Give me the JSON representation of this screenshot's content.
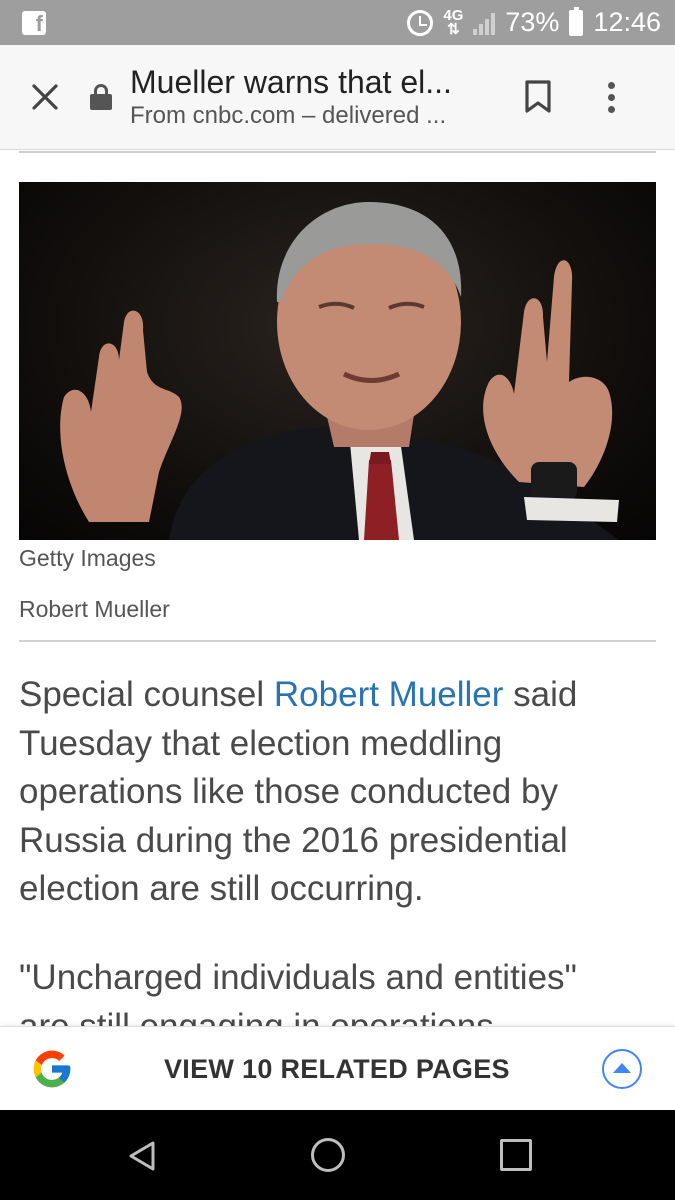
{
  "status_bar": {
    "app_icon": "facebook-icon",
    "network": "4G",
    "battery": "73%",
    "time": "12:46"
  },
  "toolbar": {
    "title": "Mueller warns that el...",
    "subtitle": "From cnbc.com – delivered ...",
    "icons": [
      "close-icon",
      "lock-icon",
      "bookmark-icon",
      "more-vert-icon"
    ]
  },
  "article": {
    "image_credit": "Getty Images",
    "image_caption": "Robert Mueller",
    "paragraph_1": {
      "before": "Special counsel ",
      "link": "Robert Mueller",
      "after": " said Tuesday that election meddling operations like those conducted by Russia during the 2016 presidential election are still occurring."
    },
    "paragraph_2": {
      "line_1": "\"Uncharged individuals and entities\"",
      "line_2": "are still engaging in operations"
    }
  },
  "related_bar": {
    "label": "VIEW 10 RELATED PAGES",
    "logo": "google-g-icon",
    "expand_icon": "chevron-up-icon"
  },
  "nav_bar": {
    "icons": [
      "back-icon",
      "home-icon",
      "recents-icon"
    ]
  },
  "colors": {
    "link": "#2a73b3",
    "body_text": "#4a4a4a",
    "status_bar": "#9e9e9e",
    "accent_blue": "#4285f4"
  }
}
